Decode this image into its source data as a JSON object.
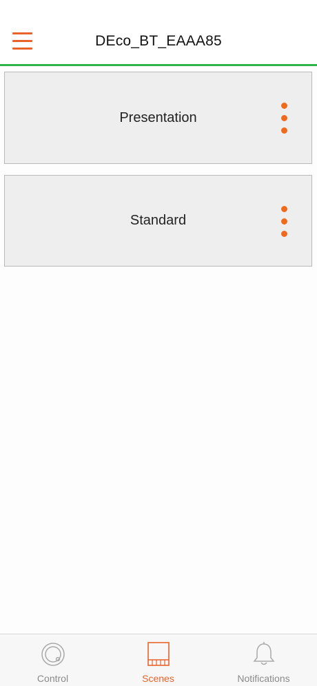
{
  "header": {
    "title": "DEco_BT_EAAA85"
  },
  "scenes": [
    {
      "label": "Presentation"
    },
    {
      "label": "Standard"
    }
  ],
  "tabs": {
    "control": "Control",
    "scenes": "Scenes",
    "notifications": "Notifications",
    "active": "Scenes"
  },
  "colors": {
    "accent": "#e8622a",
    "header_line": "#2db34a",
    "dots": "#f06a1c",
    "card_bg": "#eeeeee"
  }
}
